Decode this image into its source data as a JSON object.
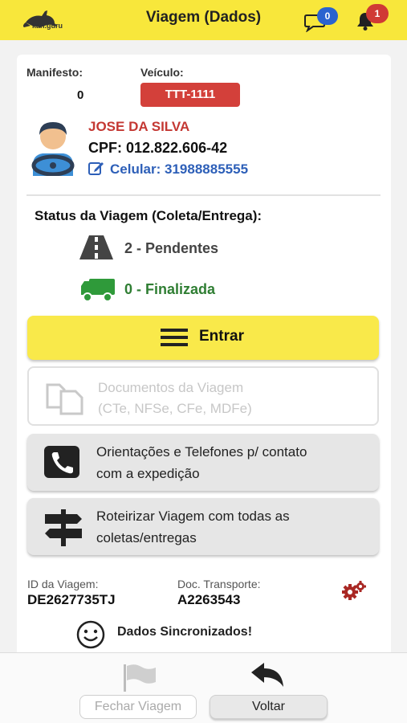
{
  "header": {
    "title": "Viagem (Dados)",
    "logo_text": "kan.guru",
    "chat_count": "0",
    "notification_count": "1"
  },
  "trip": {
    "manifest_label": "Manifesto:",
    "manifest_value": "0",
    "vehicle_label": "Veículo:",
    "vehicle_plate": "TTT-1111"
  },
  "driver": {
    "name": "JOSE DA SILVA",
    "cpf": "CPF: 012.822.606-42",
    "phone": "Celular: 31988885555"
  },
  "status": {
    "title": "Status da Viagem (Coleta/Entrega):",
    "pending": "2 - Pendentes",
    "finished": "0 - Finalizada"
  },
  "actions": {
    "enter_label": "Entrar",
    "docs_line1": "Documentos da Viagem",
    "docs_line2": "(CTe, NFSe, CFe, MDFe)",
    "contact_line1": "Orientações e Telefones p/ contato",
    "contact_line2": "com a expedição",
    "route_line1": "Roteirizar Viagem com todas as",
    "route_line2": "coletas/entregas"
  },
  "info": {
    "trip_id_label": "ID da Viagem:",
    "trip_id_value": "DE2627735TJ",
    "doc_label": "Doc. Transporte:",
    "doc_value": "A2263543",
    "sync_text": "Dados Sincronizados!"
  },
  "footer": {
    "close_label": "Fechar Viagem",
    "back_label": "Voltar"
  },
  "colors": {
    "header_bg": "#f8e73b",
    "plate_bg": "#d3403a",
    "driver_name": "#c43833",
    "phone_link": "#2d5fb8",
    "finished_green": "#2f7e33"
  },
  "icons": [
    "kangaroo-logo",
    "chat-icon",
    "bell-icon",
    "driver-avatar",
    "edit-icon",
    "road-icon",
    "truck-icon",
    "menu-icon",
    "documents-icon",
    "phone-icon",
    "signpost-icon",
    "gears-icon",
    "smile-icon",
    "flag-icon",
    "back-arrow-icon"
  ]
}
